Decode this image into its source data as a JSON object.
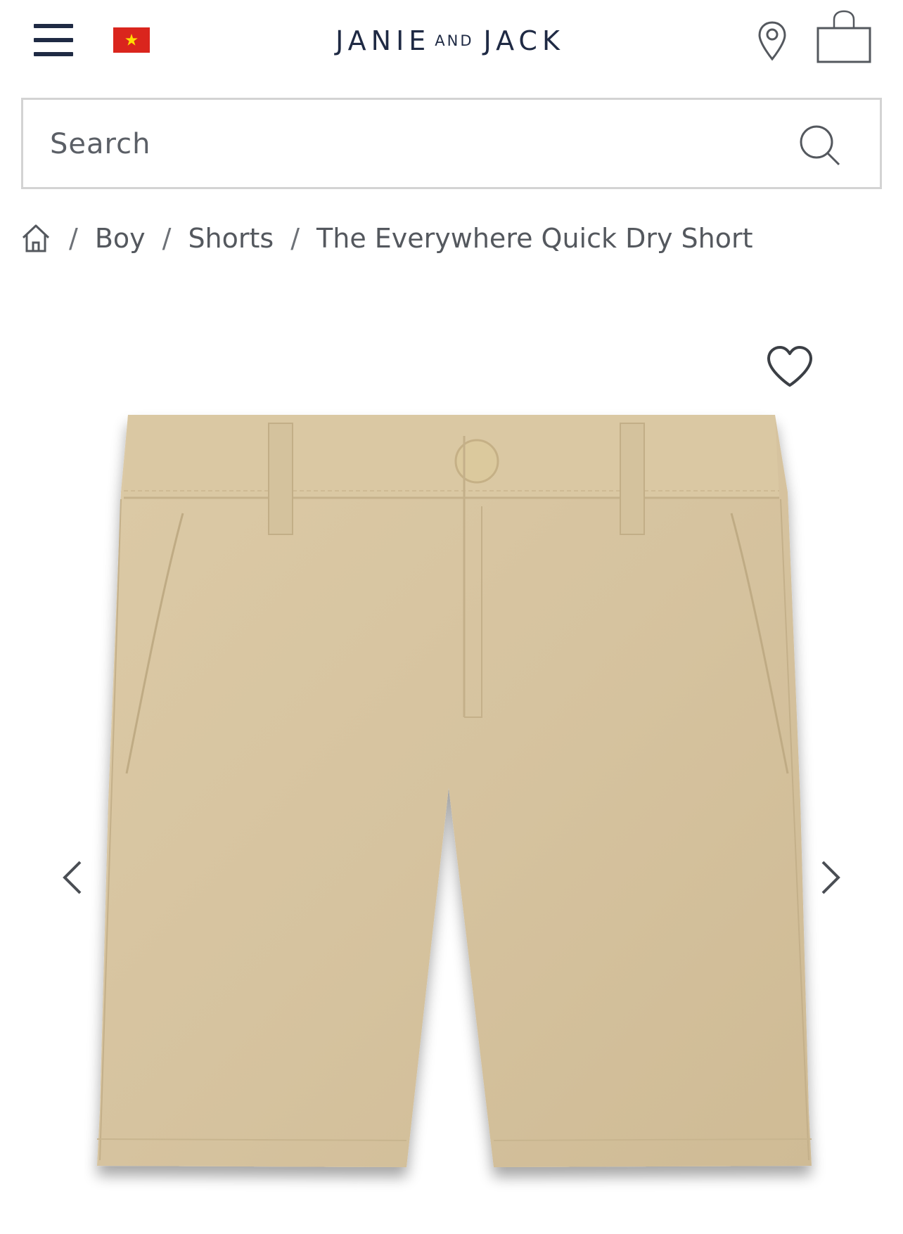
{
  "header": {
    "brand_left": "JANIE",
    "brand_middle": "AND",
    "brand_right": "JACK",
    "menu_icon": "hamburger-menu-icon",
    "flag_icon": "vietnam-flag-icon",
    "location_icon": "location-pin-icon",
    "bag_icon": "shopping-bag-icon",
    "brand_color": "#1f2a44"
  },
  "search": {
    "placeholder": "Search",
    "icon": "search-icon"
  },
  "breadcrumb": {
    "home_icon": "home-icon",
    "separator": "/",
    "items": [
      {
        "label": "Boy"
      },
      {
        "label": "Shorts"
      },
      {
        "label": "The Everywhere Quick Dry Short"
      }
    ]
  },
  "gallery": {
    "wishlist_icon": "heart-icon",
    "prev_icon": "chevron-left-icon",
    "next_icon": "chevron-right-icon",
    "product_color": "#d8c7a4"
  }
}
